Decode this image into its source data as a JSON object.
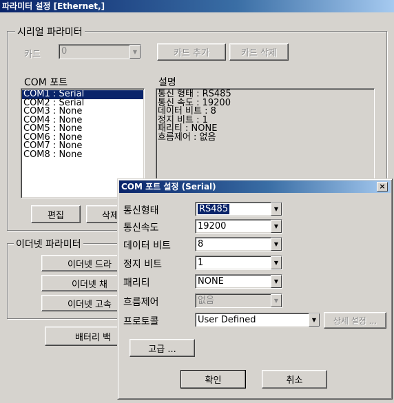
{
  "main_window": {
    "title": "파라미터 설정 [Ethernet,]",
    "serial_group": {
      "label": "시리얼 파라미터",
      "card_label": "카드",
      "card_value": "0",
      "add_card": "카드 추가",
      "delete_card": "카드 삭제",
      "com_port_label": "COM 포트",
      "description_label": "설명",
      "com_ports": [
        "COM1 : Serial",
        "COM2 : Serial",
        "COM3 : None",
        "COM4 : None",
        "COM5 : None",
        "COM6 : None",
        "COM7 : None",
        "COM8 : None"
      ],
      "selected_index": 0,
      "description_lines": [
        "통신 형태 : RS485",
        "통신 속도 : 19200",
        "데이터 비트 : 8",
        "정지 비트 : 1",
        "패리티 : NONE",
        "흐름제어 : 없음"
      ],
      "edit_button": "편집",
      "delete_button": "삭제"
    },
    "ethernet_group": {
      "label": "이더넷 파라미터",
      "btn1": "이더넷 드라",
      "btn2": "이더넷 채",
      "btn3": "이더넷 고속"
    },
    "battery_button": "배터리 백"
  },
  "dialog": {
    "title": "COM 포트 설정 (Serial)",
    "close_glyph": "×",
    "fields": {
      "comm_type": {
        "label": "통신형태",
        "value": "RS485"
      },
      "comm_speed": {
        "label": "통신속도",
        "value": "19200"
      },
      "data_bits": {
        "label": "데이터 비트",
        "value": "8"
      },
      "stop_bits": {
        "label": "정지 비트",
        "value": "1"
      },
      "parity": {
        "label": "패리티",
        "value": "NONE"
      },
      "flow_control": {
        "label": "흐름제어",
        "value": "없음"
      },
      "protocol": {
        "label": "프로토콜",
        "value": "User Defined"
      }
    },
    "detail_settings_button": "상세 설정 ...",
    "advanced_button": "고급 ...",
    "ok_button": "확인",
    "cancel_button": "취소"
  },
  "colors": {
    "face": "#d6d3ce",
    "title_start": "#0a246a",
    "title_end": "#a6caf0",
    "selection": "#0a246a"
  }
}
